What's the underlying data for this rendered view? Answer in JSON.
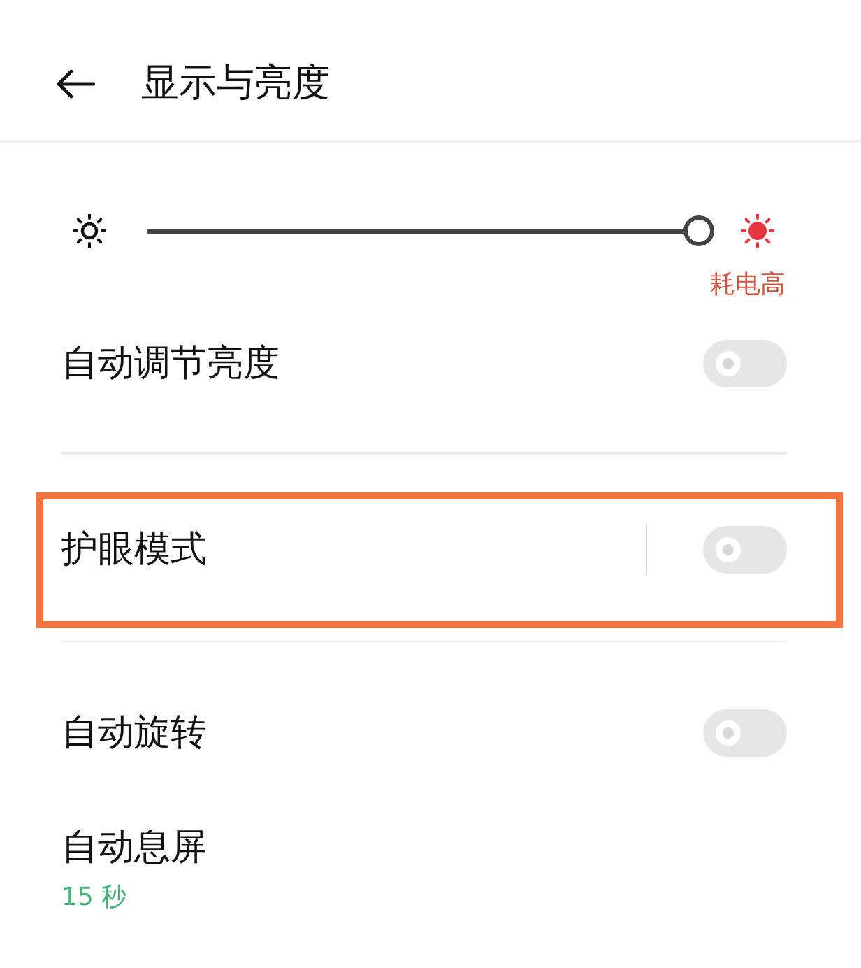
{
  "header": {
    "title": "显示与亮度"
  },
  "brightness": {
    "level": 1,
    "warning": "耗电高"
  },
  "sections": [
    {
      "highlighted": false,
      "items": [
        {
          "kind": "toggle",
          "label": "自动调节亮度",
          "on": false,
          "split": false
        }
      ]
    },
    {
      "highlighted": true,
      "items": [
        {
          "kind": "toggle",
          "label": "护眼模式",
          "on": false,
          "split": true
        }
      ]
    },
    {
      "highlighted": false,
      "items": [
        {
          "kind": "toggle",
          "label": "自动旋转",
          "on": false,
          "split": false
        },
        {
          "kind": "value",
          "label": "自动息屏",
          "value": "15 秒"
        }
      ]
    }
  ]
}
